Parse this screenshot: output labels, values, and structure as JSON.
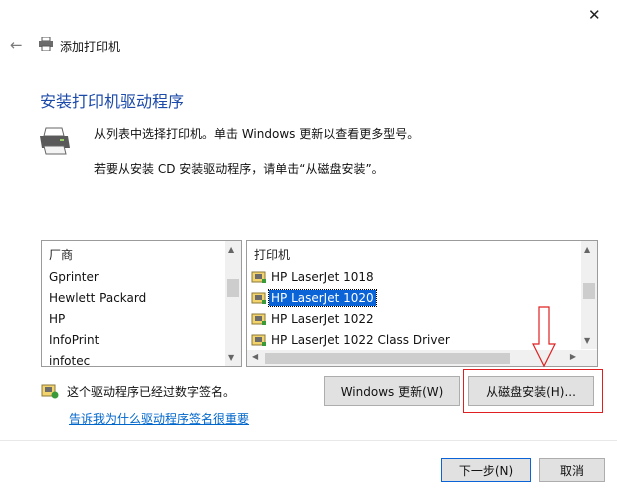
{
  "window": {
    "close_glyph": "✕",
    "back_glyph": "←",
    "title": "添加打印机"
  },
  "header": {
    "heading": "安装打印机驱动程序",
    "desc_line1": "从列表中选择打印机。单击 Windows 更新以查看更多型号。",
    "desc_line2": "若要从安装 CD 安装驱动程序，请单击“从磁盘安装”。"
  },
  "manufacturers": {
    "header": "厂商",
    "items": [
      "Gprinter",
      "Hewlett Packard",
      "HP",
      "InfoPrint",
      "infotec"
    ],
    "selected": "HP"
  },
  "printers": {
    "header": "打印机",
    "items": [
      "HP LaserJet 1018",
      "HP LaserJet 1020",
      "HP LaserJet 1022",
      "HP LaserJet 1022 Class Driver"
    ],
    "selected": "HP LaserJet 1020"
  },
  "buttons": {
    "windows_update": "Windows 更新(W)",
    "have_disk": "从磁盘安装(H)...",
    "next": "下一步(N)",
    "cancel": "取消"
  },
  "signing": {
    "status": "这个驱动程序已经过数字签名。",
    "link": "告诉我为什么驱动程序签名很重要"
  },
  "icons": {
    "back": "back-arrow-icon",
    "printer": "printer-icon",
    "shield": "signed-driver-icon"
  },
  "colors": {
    "heading": "#1b4aa8",
    "selection": "#0a64d8",
    "link": "#0066cc",
    "annotation": "#e02020"
  }
}
